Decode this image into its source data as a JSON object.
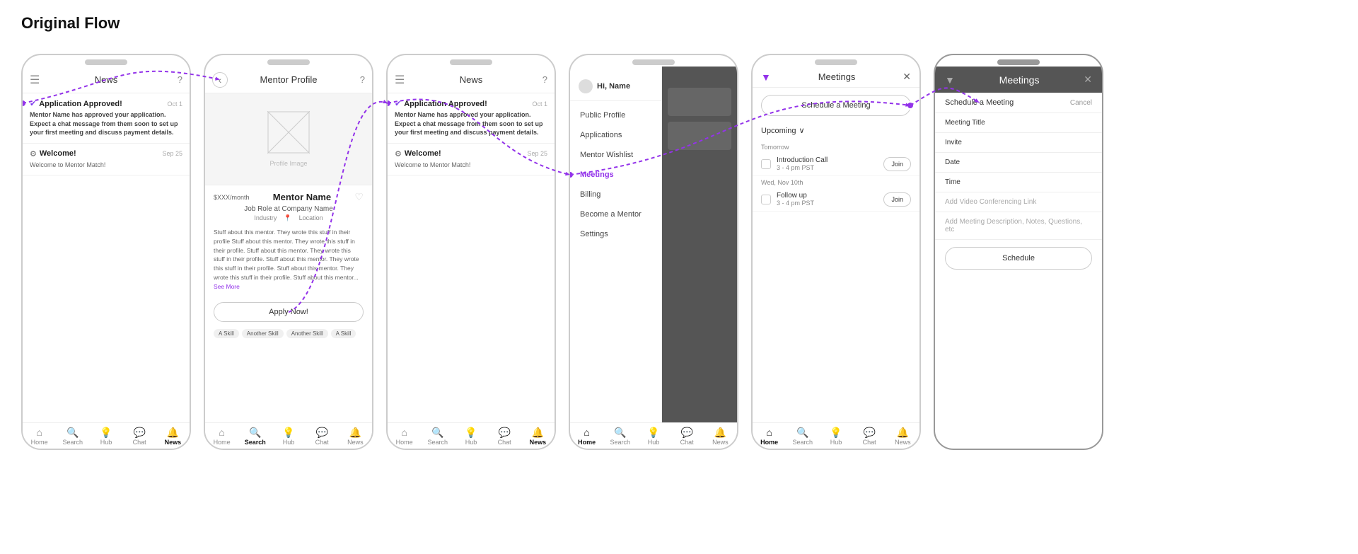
{
  "page": {
    "title": "Original Flow"
  },
  "phones": [
    {
      "id": "phone1",
      "header": {
        "left": "☰",
        "title": "News",
        "right": "?"
      },
      "notifications": [
        {
          "type": "approved",
          "title": "Application Approved!",
          "date": "Oct 1",
          "body_bold": "Mentor Name",
          "body": " has approved your application. Expect a chat message from them soon to set up your first meeting and discuss payment details."
        },
        {
          "type": "welcome",
          "title": "Welcome!",
          "date": "Sep 25",
          "body": "Welcome to Mentor Match!"
        }
      ],
      "nav": [
        "Home",
        "Search",
        "Hub",
        "Chat",
        "News"
      ],
      "active_nav": "News"
    },
    {
      "id": "phone2",
      "header": {
        "left": "‹",
        "title": "Mentor Profile",
        "right": "?"
      },
      "mentor": {
        "price": "$XXX/month",
        "name": "Mentor Name",
        "role": "Job Role at Company Name",
        "industry": "Industry",
        "location": "Location",
        "bio": "Stuff about this mentor. They wrote this stuff in their profile Stuff about this mentor. They wrote this stuff in their profile. Stuff about this mentor. They wrote this stuff in their profile. Stuff about this mentor. They wrote this stuff in their profile. Stuff about this mentor. They wrote this stuff in their profile. Stuff about this mentor...",
        "see_more": "See More",
        "apply_button": "Apply Now!",
        "tags": [
          "A Skill",
          "Another Skill",
          "Another Skill",
          "A Skill"
        ]
      },
      "nav": [
        "Home",
        "Search",
        "Hub",
        "Chat",
        "News"
      ],
      "active_nav": "Search"
    },
    {
      "id": "phone3",
      "header": {
        "left": "☰",
        "title": "News",
        "right": "?"
      },
      "notifications": [
        {
          "type": "approved",
          "title": "Application Approved!",
          "date": "Oct 1",
          "body_bold": "Mentor Name",
          "body": " has approved your application. Expect a chat message from them soon to set up your first meeting and discuss payment details."
        },
        {
          "type": "welcome",
          "title": "Welcome!",
          "date": "Sep 25",
          "body": "Welcome to Mentor Match!"
        }
      ],
      "nav": [
        "Home",
        "Search",
        "Hub",
        "Chat",
        "News"
      ],
      "active_nav": "News"
    },
    {
      "id": "phone4",
      "header": {},
      "sidebar": {
        "username": "Hi, Name",
        "items": [
          "Public Profile",
          "Applications",
          "Mentor Wishlist",
          "Meetings",
          "Billing",
          "Become a Mentor",
          "Settings"
        ],
        "active_item": "Meetings"
      },
      "nav": [
        "Home",
        "Search",
        "Hub",
        "Chat",
        "News"
      ],
      "active_nav": "Home"
    },
    {
      "id": "phone5",
      "header": {
        "filter": true,
        "title": "Meetings",
        "close": true
      },
      "meetings": {
        "schedule_button": "Schedule a Meeting",
        "upcoming_label": "Upcoming",
        "sections": [
          {
            "date_label": "Tomorrow",
            "items": [
              {
                "name": "Introduction Call",
                "time": "3 - 4 pm PST",
                "join": "Join"
              }
            ]
          },
          {
            "date_label": "Wed, Nov 10th",
            "items": [
              {
                "name": "Follow up",
                "time": "3 - 4 pm PST",
                "join": "Join"
              }
            ]
          }
        ]
      },
      "nav": [
        "Home",
        "Search",
        "Hub",
        "Chat",
        "News"
      ],
      "active_nav": "Home"
    },
    {
      "id": "phone6",
      "type": "schedule",
      "header": {
        "title": "Meetings",
        "filter": true,
        "close": true
      },
      "schedule": {
        "subtitle": "Schedule a Meeting",
        "cancel": "Cancel",
        "fields": [
          {
            "label": "Meeting Title",
            "placeholder": ""
          },
          {
            "label": "Invite",
            "placeholder": ""
          },
          {
            "label": "Date",
            "placeholder": ""
          },
          {
            "label": "Time",
            "placeholder": ""
          },
          {
            "label": "Add Video Conferencing Link",
            "placeholder": ""
          },
          {
            "label": "Add Meeting Description, Notes, Questions, etc",
            "placeholder": ""
          }
        ],
        "submit_button": "Schedule"
      }
    }
  ],
  "nav_icons": {
    "Home": "⌂",
    "Search": "🔍",
    "Hub": "💡",
    "Chat": "💬",
    "News": "🔔"
  }
}
